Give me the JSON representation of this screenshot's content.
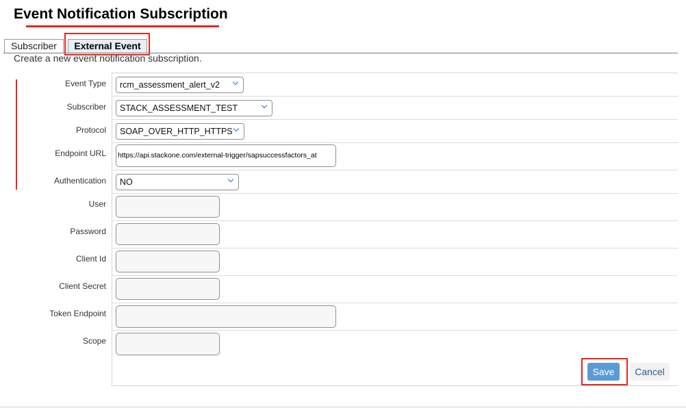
{
  "page": {
    "title": "Event Notification Subscription",
    "intro": "Create a new event notification subscription."
  },
  "tabs": [
    {
      "label": "Subscriber",
      "active": false
    },
    {
      "label": "External Event",
      "active": true
    }
  ],
  "form": {
    "event_type": {
      "label": "Event Type",
      "value": "rcm_assessment_alert_v2"
    },
    "subscriber": {
      "label": "Subscriber",
      "value": "STACK_ASSESSMENT_TEST"
    },
    "protocol": {
      "label": "Protocol",
      "value": "SOAP_OVER_HTTP_HTTPS"
    },
    "endpoint_url": {
      "label": "Endpoint URL",
      "value": "https://api.stackone.com/external-trigger/sapsuccessfactors_at"
    },
    "authentication": {
      "label": "Authentication",
      "value": "NO"
    },
    "user": {
      "label": "User",
      "value": ""
    },
    "password": {
      "label": "Password",
      "value": ""
    },
    "client_id": {
      "label": "Client Id",
      "value": ""
    },
    "client_secret": {
      "label": "Client Secret",
      "value": ""
    },
    "token_endpoint": {
      "label": "Token Endpoint",
      "value": ""
    },
    "scope": {
      "label": "Scope",
      "value": ""
    }
  },
  "actions": {
    "save_label": "Save",
    "cancel_label": "Cancel"
  },
  "colors": {
    "highlight": "#e8261b",
    "primary_button": "#5b9bd5",
    "active_tab": "#e9eef4"
  }
}
